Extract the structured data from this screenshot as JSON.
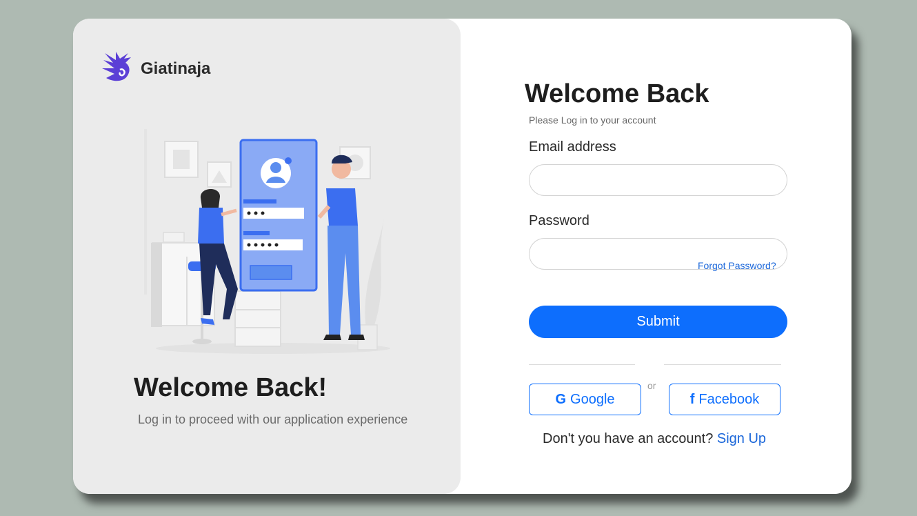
{
  "brand": {
    "name": "Giatinaja"
  },
  "hero": {
    "title": "Welcome Back!",
    "subtitle": "Log in to proceed with our application experience"
  },
  "form": {
    "title": "Welcome Back",
    "subtitle": "Please Log in to your account",
    "email_label": "Email address",
    "email_value": "",
    "password_label": "Password",
    "password_value": "",
    "forgot_label": "Forgot Password?",
    "submit_label": "Submit",
    "or_label": "or",
    "google_icon": "G",
    "google_label": "Google",
    "facebook_icon": "f",
    "facebook_label": "Facebook",
    "signup_prompt": "Don't you have an account?",
    "signup_link": "Sign Up"
  },
  "colors": {
    "background": "#aebab2",
    "panel": "#ebebeb",
    "accent": "#0d6efd",
    "illustration_blue": "#5b8def"
  },
  "icons": {
    "brand": "hand-logo-icon",
    "illustration": "login-illustration",
    "google": "google-icon",
    "facebook": "facebook-icon"
  }
}
